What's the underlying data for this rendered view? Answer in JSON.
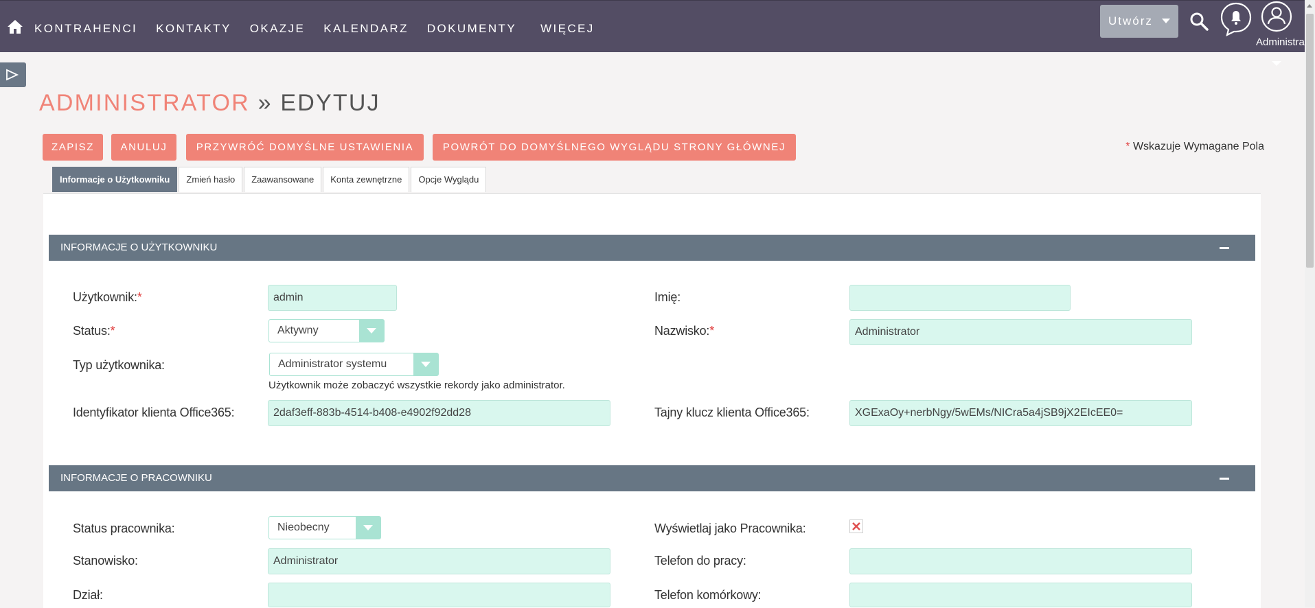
{
  "nav": {
    "items": [
      "KONTRAHENCI",
      "KONTAKTY",
      "OKAZJE",
      "KALENDARZ",
      "DOKUMENTY"
    ],
    "more": "WIĘCEJ",
    "create": "Utwórz",
    "user": "Administrator"
  },
  "title": {
    "module": "ADMINISTRATOR",
    "sep": "»",
    "action": "EDYTUJ"
  },
  "buttons": {
    "save": "ZAPISZ",
    "cancel": "ANULUJ",
    "restore": "PRZYWRÓĆ DOMYŚLNE USTAWIENIA",
    "home_layout": "POWRÓT DO DOMYŚLNEGO WYGLĄDU STRONY GŁÓWNEJ"
  },
  "required_note": "Wskazuje Wymagane Pola",
  "tabs": [
    "Informacje o Użytkowniku",
    "Zmień hasło",
    "Zaawansowane",
    "Konta zewnętrzne",
    "Opcje Wyglądu"
  ],
  "user_info": {
    "header": "INFORMACJE O UŻYTKOWNIKU",
    "username_label": "Użytkownik:",
    "username": "admin",
    "firstname_label": "Imię:",
    "firstname": "",
    "status_label": "Status:",
    "status": "Aktywny",
    "lastname_label": "Nazwisko:",
    "lastname": "Administrator",
    "usertype_label": "Typ użytkownika:",
    "usertype": "Administrator systemu",
    "usertype_help": "Użytkownik może zobaczyć wszystkie rekordy jako administrator.",
    "client_id_label": "Identyfikator klienta Office365:",
    "client_id": "2daf3eff-883b-4514-b408-e4902f92dd28",
    "secret_label": "Tajny klucz klienta Office365:",
    "secret": "XGExaOy+nerbNgy/5wEMs/NICra5a4jSB9jX2EIcEE0="
  },
  "employee_info": {
    "header": "INFORMACJE O PRACOWNIKU",
    "emp_status_label": "Status pracownika:",
    "emp_status": "Nieobecny",
    "show_emp_label": "Wyświetlaj jako Pracownika:",
    "title_label": "Stanowisko:",
    "title": "Administrator",
    "work_phone_label": "Telefon do pracy:",
    "work_phone": "",
    "department_label": "Dział:",
    "department": "",
    "mobile_label": "Telefon komórkowy:",
    "mobile": ""
  },
  "colors": {
    "topbar": "#534d64",
    "accent": "#f08377",
    "section": "#677684",
    "field": "#d9f7ee"
  }
}
